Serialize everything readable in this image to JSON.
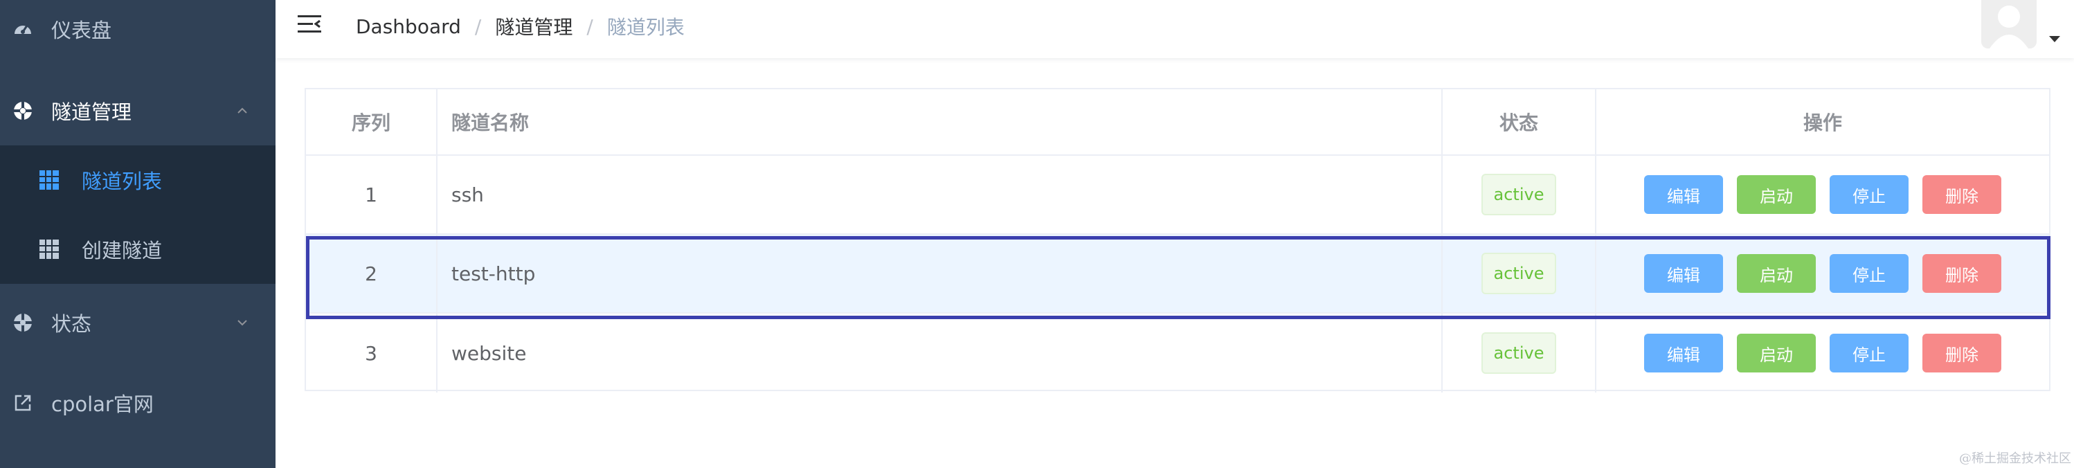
{
  "sidebar": {
    "dashboard_label": "仪表盘",
    "tunnel_mgmt_label": "隧道管理",
    "tunnel_list_label": "隧道列表",
    "create_tunnel_label": "创建隧道",
    "status_label": "状态",
    "cpolar_label": "cpolar官网"
  },
  "breadcrumb": {
    "item1": "Dashboard",
    "sep": "/",
    "item2": "隧道管理",
    "item3": "隧道列表"
  },
  "table": {
    "headers": [
      "序列",
      "隧道名称",
      "状态",
      "操作"
    ],
    "rows": [
      {
        "index": "1",
        "name": "ssh",
        "status": "active"
      },
      {
        "index": "2",
        "name": "test-http",
        "status": "active"
      },
      {
        "index": "3",
        "name": "website",
        "status": "active"
      }
    ],
    "actions": {
      "edit": "编辑",
      "start": "启动",
      "stop": "停止",
      "delete": "删除"
    }
  },
  "watermark": "@稀土掘金技术社区",
  "colors": {
    "sidebar_bg": "#304156",
    "submenu_bg": "#1f2d3d",
    "active_accent": "#409eff",
    "tag_green": "#67c23a",
    "highlight_border": "#3b3fae"
  },
  "icons": [
    "dashboard-icon",
    "tunnel-icon",
    "grid-icon",
    "status-icon",
    "external-link-icon",
    "hamburger-icon",
    "avatar-icon"
  ]
}
